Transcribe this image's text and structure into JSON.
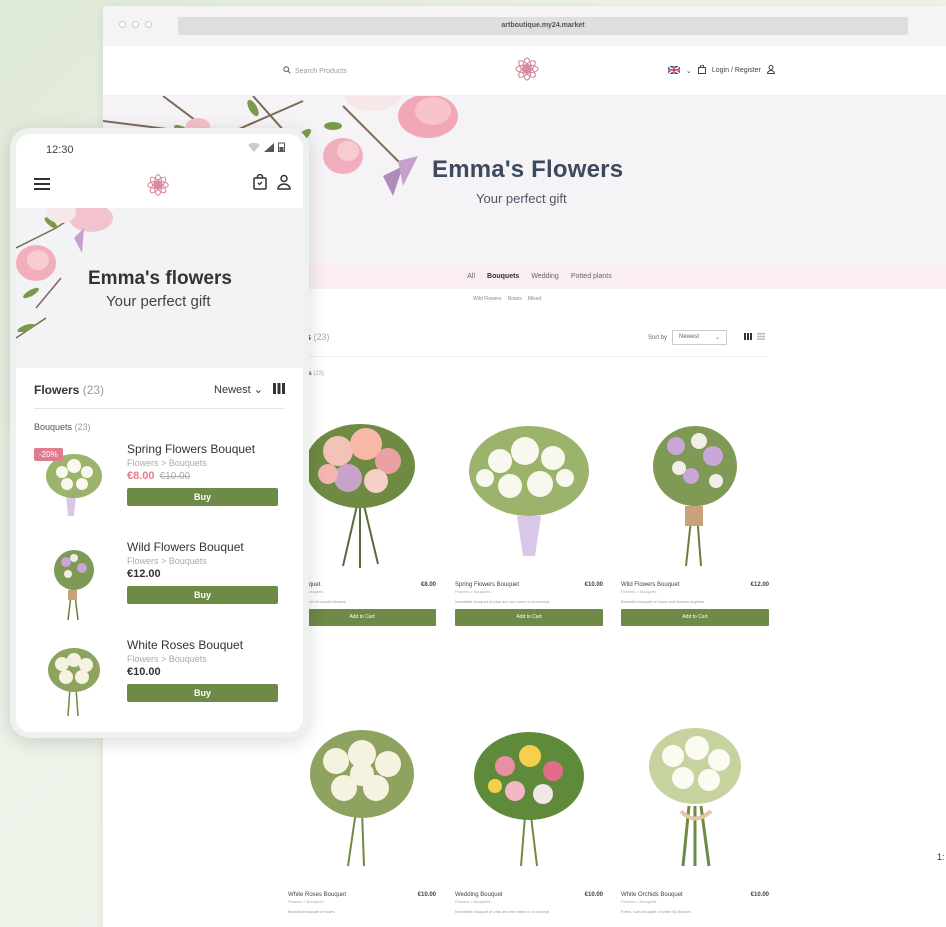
{
  "browser": {
    "url": "artboutique.my24.market"
  },
  "desktop": {
    "search_placeholder": "Search Products",
    "login_label": "Login / Register",
    "hero_title": "Emma's Flowers",
    "hero_subtitle": "Your perfect gift",
    "categories": [
      {
        "label": "All",
        "active": false
      },
      {
        "label": "Bouquets",
        "active": true
      },
      {
        "label": "Wedding",
        "active": false
      },
      {
        "label": "Potted plants",
        "active": false
      }
    ],
    "subcategories": [
      "Wild Flowers",
      "Roses",
      "Mixed"
    ],
    "list_title": "ets",
    "list_count": "(23)",
    "sub_label": "wers",
    "sub_count": "(23)",
    "sort_label": "Sort by",
    "sort_value": "Newest",
    "products": [
      {
        "name": "rse Bouquet",
        "price": "€8.00",
        "crumb": "Flowers > Bouquets",
        "desc": "lovely bouquet of colorful flowers",
        "button": "Add to Cart"
      },
      {
        "name": "Spring Flowers Bouquet",
        "price": "€10.00",
        "crumb": "Flowers > Bouquets",
        "desc": "Incredible bouquet of pink and red roses in a concept",
        "button": "Add to Cart"
      },
      {
        "name": "Wild Flowers Bouquet",
        "price": "€12.00",
        "crumb": "Flowers > Bouquets",
        "desc": "Beautiful bouquet of roses and flowers anytime",
        "button": "Add to Cart"
      },
      {
        "name": "White Roses Bouquet",
        "price": "€10.00",
        "crumb": "Flowers > Bouquets",
        "desc": "Beautiful bouquet of roses",
        "button": ""
      },
      {
        "name": "Wedding Bouquet",
        "price": "€10.00",
        "crumb": "Flowers > Bouquets",
        "desc": "Incredible bouquet of pink and red roses in a concept",
        "button": ""
      },
      {
        "name": "White Orchids Bouquet",
        "price": "€10.00",
        "crumb": "Flowers > Bouquets",
        "desc": "Fresh, lush bouquet of white lily flowers",
        "button": ""
      }
    ]
  },
  "mobile": {
    "time": "12:30",
    "hero_title": "Emma's flowers",
    "hero_subtitle": "Your perfect gift",
    "list_title": "Flowers",
    "list_count": "(23)",
    "sort_value": "Newest",
    "sub_label": "Bouquets",
    "sub_count": "(23)",
    "items": [
      {
        "name": "Spring Flowers Bouquet",
        "crumb": "Flowers > Bouquets",
        "price": "€8.00",
        "old_price": "€10.00",
        "badge": "-20%",
        "button": "Buy"
      },
      {
        "name": "Wild Flowers Bouquet",
        "crumb": "Flowers > Bouquets",
        "price": "€12.00",
        "old_price": "",
        "badge": "",
        "button": "Buy"
      },
      {
        "name": "White Roses Bouquet",
        "crumb": "Flowers > Bouquets",
        "price": "€10.00",
        "old_price": "",
        "badge": "",
        "button": "Buy"
      }
    ]
  },
  "side_text": "1:",
  "colors": {
    "accent_green": "#6d8a47",
    "sale_pink": "#e07c8f",
    "hero_title": "#3c4a5e",
    "category_bar": "#fbeef0",
    "background": "#e7efe2"
  }
}
